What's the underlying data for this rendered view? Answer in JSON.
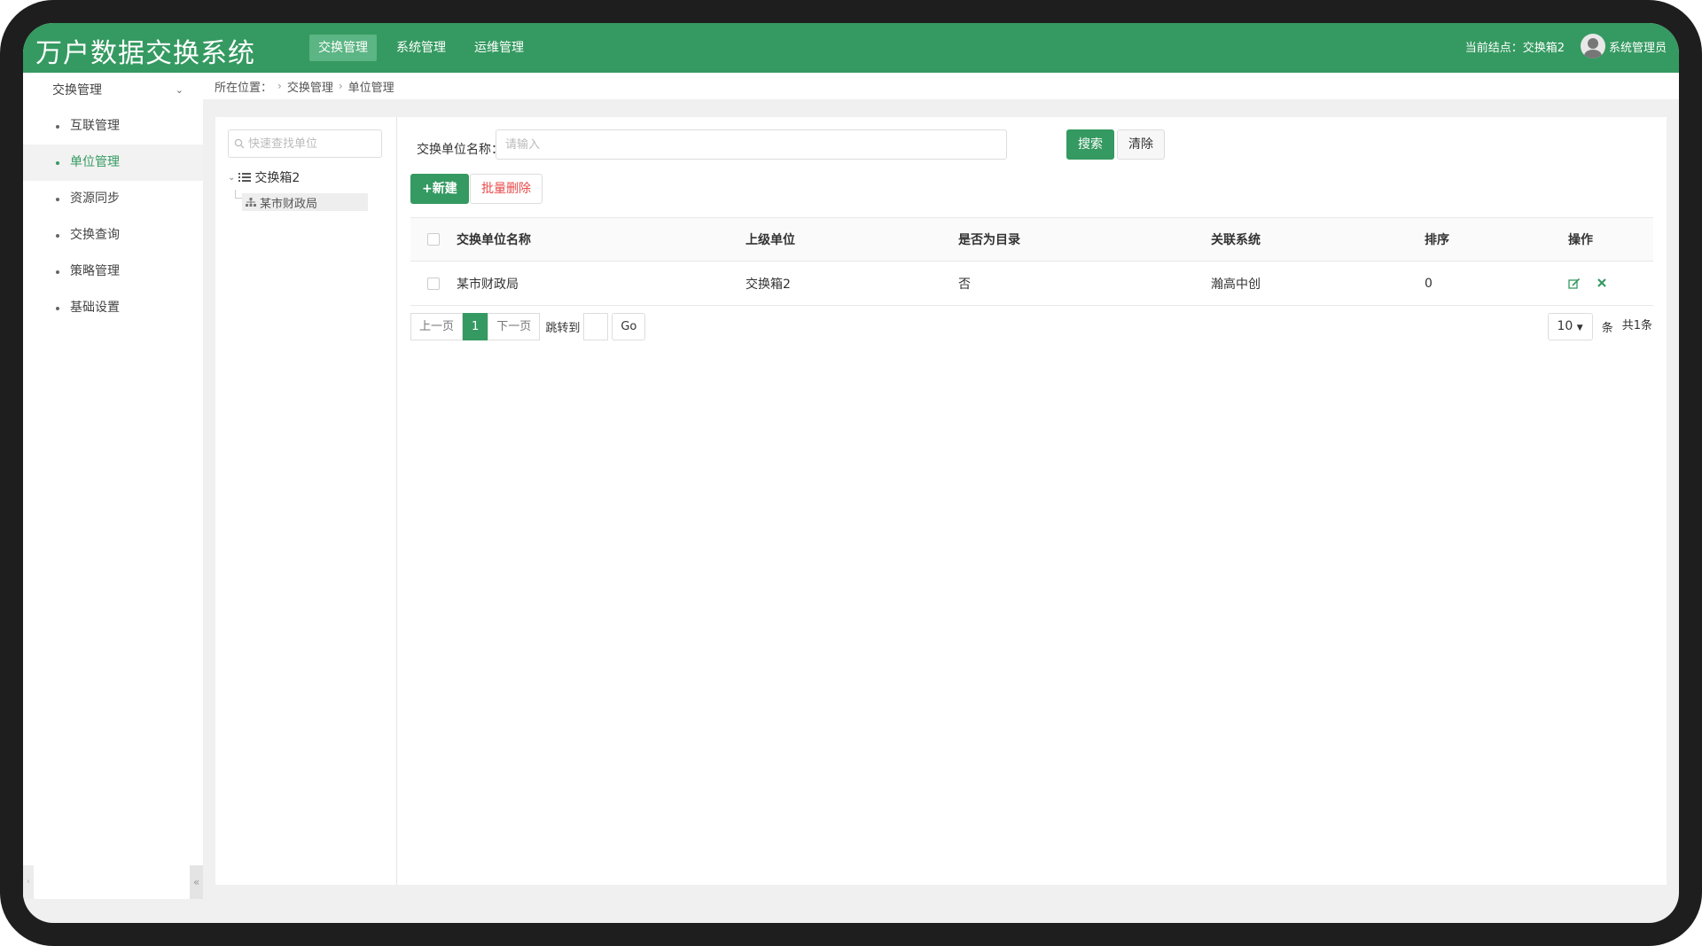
{
  "header": {
    "title": "万户数据交换系统",
    "nav": [
      {
        "label": "交换管理",
        "active": true
      },
      {
        "label": "系统管理",
        "active": false
      },
      {
        "label": "运维管理",
        "active": false
      }
    ],
    "node_label": "当前结点：交换箱2",
    "user_name": "系统管理员"
  },
  "sidebar": {
    "group_label": "交换管理",
    "items": [
      {
        "label": "互联管理"
      },
      {
        "label": "单位管理"
      },
      {
        "label": "资源同步"
      },
      {
        "label": "交换查询"
      },
      {
        "label": "策略管理"
      },
      {
        "label": "基础设置"
      }
    ]
  },
  "breadcrumb": {
    "prefix": "所在位置：",
    "items": [
      "交换管理",
      "单位管理"
    ]
  },
  "tree": {
    "search_placeholder": "快速查找单位",
    "root_label": "交换箱2",
    "child_label": "某市财政局"
  },
  "filter": {
    "label": "交换单位名称：",
    "placeholder": "请输入",
    "search_label": "搜索",
    "clear_label": "清除"
  },
  "toolbar": {
    "new_label": "+新建",
    "batch_delete_label": "批量删除"
  },
  "table": {
    "columns": [
      "交换单位名称",
      "上级单位",
      "是否为目录",
      "关联系统",
      "排序",
      "操作"
    ],
    "rows": [
      {
        "name": "某市财政局",
        "parent": "交换箱2",
        "is_dir": "否",
        "system": "瀚高中创",
        "order": "0"
      }
    ]
  },
  "pager": {
    "prev": "上一页",
    "current": "1",
    "next": "下一页",
    "jump_label": "跳转到",
    "go_label": "Go",
    "page_size": "10",
    "unit": "条",
    "total": "共1条"
  },
  "colors": {
    "brand": "#359a61",
    "danger": "#e84a4a"
  }
}
